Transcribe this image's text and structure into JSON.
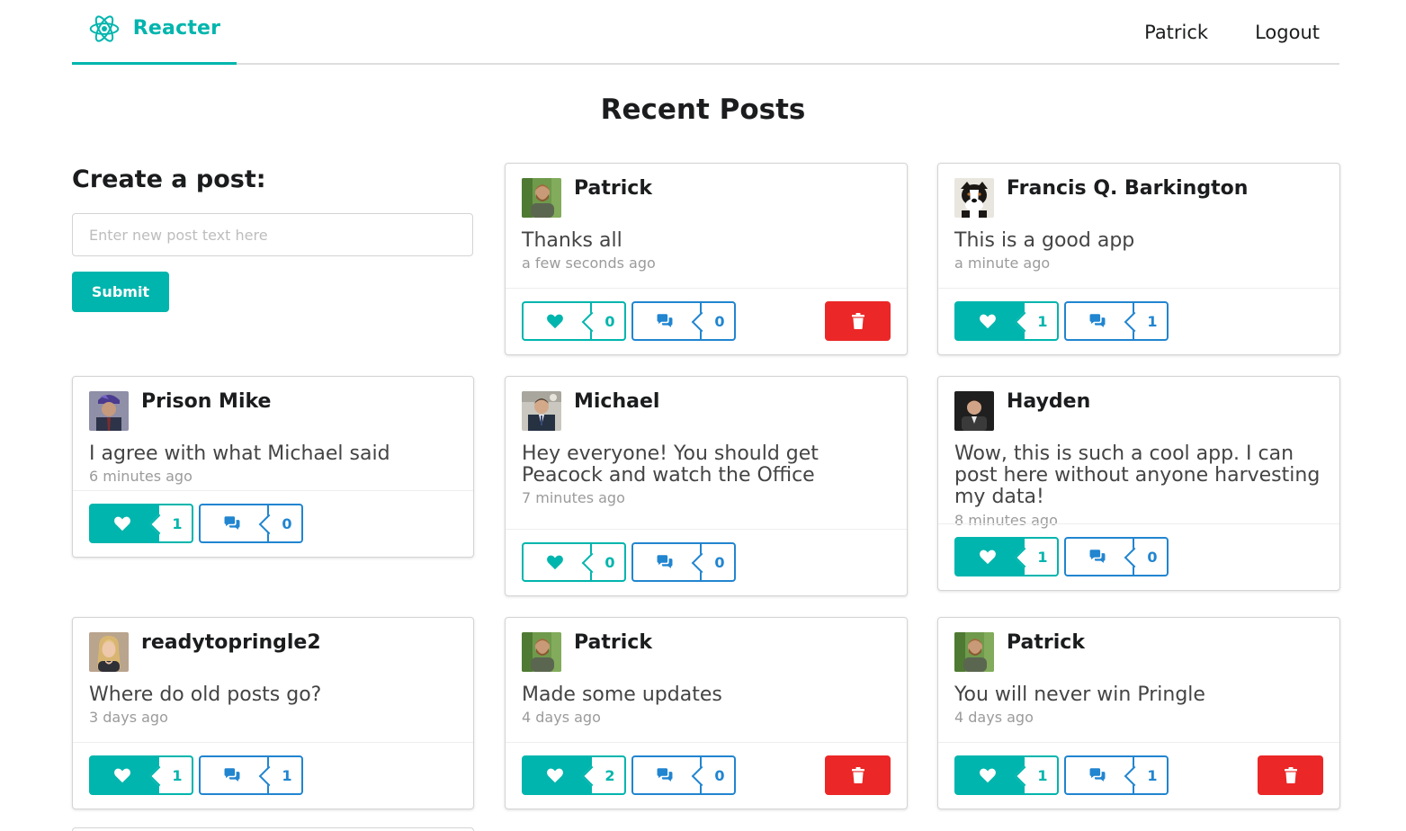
{
  "header": {
    "brand": "Reacter",
    "brand_icon": "react-atom-icon",
    "nav": [
      "Patrick",
      "Logout"
    ]
  },
  "page_title": "Recent Posts",
  "create": {
    "heading": "Create a post:",
    "placeholder": "Enter new post text here",
    "input_value": "",
    "submit_label": "Submit"
  },
  "colors": {
    "accent": "#00b5ad",
    "comment_blue": "#2185d0",
    "delete_red": "#eb2727"
  },
  "posts": [
    {
      "author": "Patrick",
      "text": "Thanks all",
      "time": "a few seconds ago",
      "likes": "0",
      "comments": "0",
      "liked": false,
      "deletable": true,
      "avatar": "patrick"
    },
    {
      "author": "Francis Q. Barkington",
      "text": "This is a good app",
      "time": "a minute ago",
      "likes": "1",
      "comments": "1",
      "liked": true,
      "deletable": false,
      "avatar": "dog"
    },
    {
      "author": "Prison Mike",
      "text": "I agree with what Michael said",
      "time": "6 minutes ago",
      "likes": "1",
      "comments": "0",
      "liked": true,
      "deletable": false,
      "avatar": "prisonmike"
    },
    {
      "author": "Michael",
      "text": "Hey everyone! You should get Peacock and watch the Office",
      "time": "7 minutes ago",
      "likes": "0",
      "comments": "0",
      "liked": false,
      "deletable": false,
      "avatar": "michael"
    },
    {
      "author": "Hayden",
      "text": "Wow, this is such a cool app. I can post here without anyone harvesting my data!",
      "time": "8 minutes ago",
      "likes": "1",
      "comments": "0",
      "liked": true,
      "deletable": false,
      "avatar": "hayden"
    },
    {
      "author": "readytopringle2",
      "text": "Where do old posts go?",
      "time": "3 days ago",
      "likes": "1",
      "comments": "1",
      "liked": true,
      "deletable": false,
      "avatar": "woman"
    },
    {
      "author": "Patrick",
      "text": "Made some updates",
      "time": "4 days ago",
      "likes": "2",
      "comments": "0",
      "liked": true,
      "deletable": true,
      "avatar": "patrick"
    },
    {
      "author": "Patrick",
      "text": "You will never win Pringle",
      "time": "4 days ago",
      "likes": "1",
      "comments": "1",
      "liked": true,
      "deletable": true,
      "avatar": "patrick"
    }
  ]
}
